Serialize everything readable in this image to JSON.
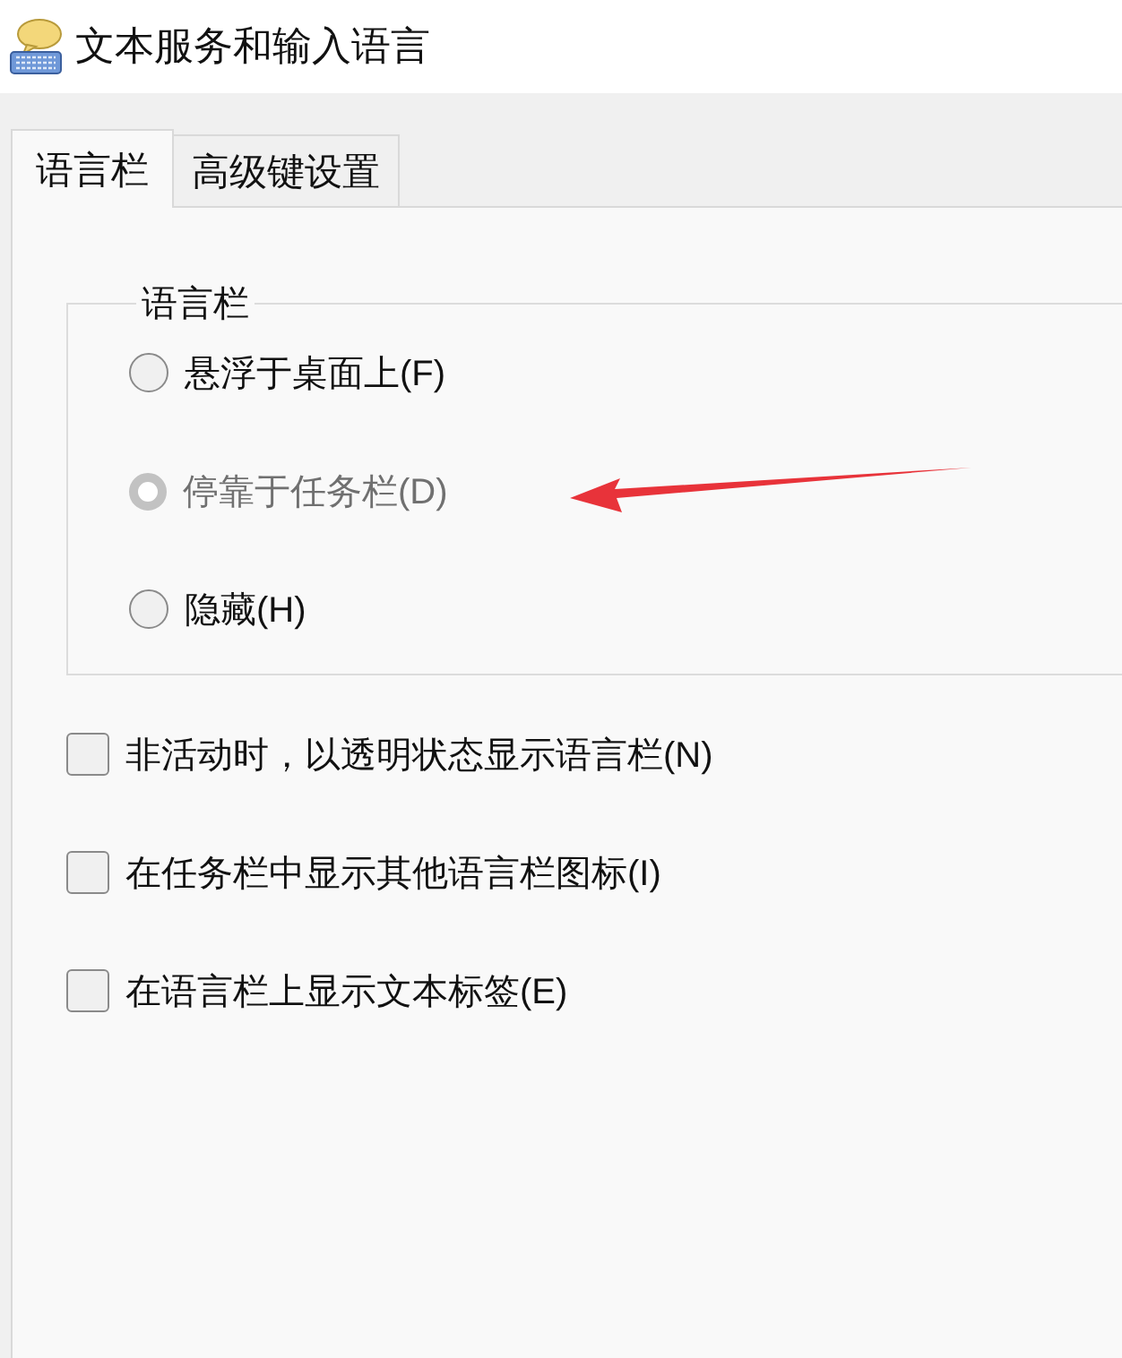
{
  "window": {
    "title": "文本服务和输入语言"
  },
  "tabs": [
    {
      "label": "语言栏",
      "selected": true
    },
    {
      "label": "高级键设置",
      "selected": false
    }
  ],
  "language_bar_group": {
    "title": "语言栏",
    "options": [
      {
        "label": "悬浮于桌面上(F)",
        "selected": false,
        "disabled": false,
        "annotated": false
      },
      {
        "label": "停靠于任务栏(D)",
        "selected": true,
        "disabled": true,
        "annotated": true
      },
      {
        "label": "隐藏(H)",
        "selected": false,
        "disabled": false,
        "annotated": false
      }
    ]
  },
  "checkboxes": [
    {
      "label": "非活动时，以透明状态显示语言栏(N)",
      "checked": false
    },
    {
      "label": "在任务栏中显示其他语言栏图标(I)",
      "checked": false
    },
    {
      "label": "在语言栏上显示文本标签(E)",
      "checked": false
    }
  ]
}
